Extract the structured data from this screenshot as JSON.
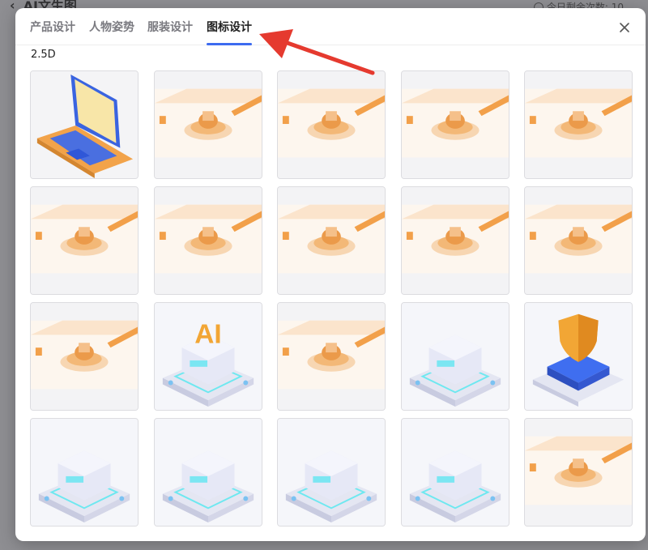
{
  "background": {
    "app_title": "AI文生图",
    "remaining_label": "今日剩余次数: 10"
  },
  "modal": {
    "tabs": [
      {
        "label": "产品设计"
      },
      {
        "label": "人物姿势"
      },
      {
        "label": "服装设计"
      },
      {
        "label": "图标设计",
        "active": true
      }
    ],
    "section_label": "2.5D",
    "accent_color": "#3d6bf0",
    "annotation_arrow_color": "#e53a2f",
    "tiles": [
      {
        "style": "laptop"
      },
      {
        "style": "orange-iso"
      },
      {
        "style": "orange-iso"
      },
      {
        "style": "orange-iso"
      },
      {
        "style": "orange-iso"
      },
      {
        "style": "orange-iso"
      },
      {
        "style": "orange-iso"
      },
      {
        "style": "orange-iso"
      },
      {
        "style": "orange-iso"
      },
      {
        "style": "orange-iso"
      },
      {
        "style": "orange-iso"
      },
      {
        "style": "blue-platform",
        "glyph": "AI"
      },
      {
        "style": "orange-iso"
      },
      {
        "style": "blue-platform"
      },
      {
        "style": "blue-shield"
      },
      {
        "style": "blue-platform"
      },
      {
        "style": "blue-platform"
      },
      {
        "style": "blue-platform"
      },
      {
        "style": "blue-platform"
      },
      {
        "style": "orange-iso"
      }
    ]
  }
}
